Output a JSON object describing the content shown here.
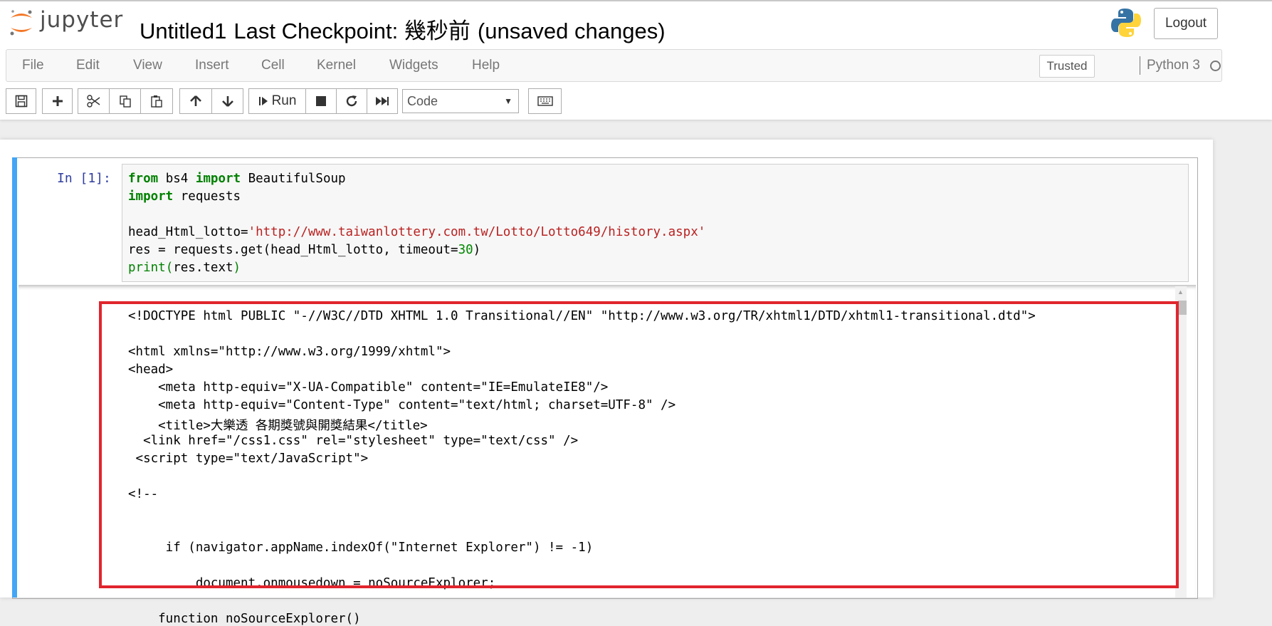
{
  "header": {
    "logo_text": "jupyter",
    "notebook_name": "Untitled1",
    "checkpoint": "Last Checkpoint: 幾秒前",
    "save_status": "(unsaved changes)",
    "logout_label": "Logout"
  },
  "menubar": {
    "items": [
      "File",
      "Edit",
      "View",
      "Insert",
      "Cell",
      "Kernel",
      "Widgets",
      "Help"
    ],
    "trusted_label": "Trusted",
    "kernel_name": "Python 3"
  },
  "toolbar": {
    "run_label": "Run",
    "cell_type": "Code",
    "icons": [
      "save-icon",
      "plus-icon",
      "cut-icon",
      "copy-icon",
      "paste-icon",
      "arrow-up-icon",
      "arrow-down-icon",
      "step-forward-icon",
      "stop-icon",
      "restart-icon",
      "fast-forward-icon",
      "keyboard-icon"
    ]
  },
  "cell": {
    "prompt": "In [1]:",
    "code": [
      [
        {
          "t": "from",
          "c": "kw"
        },
        {
          "t": " bs4 ",
          "c": ""
        },
        {
          "t": "import",
          "c": "kw"
        },
        {
          "t": " BeautifulSoup",
          "c": ""
        }
      ],
      [
        {
          "t": "import",
          "c": "kw"
        },
        {
          "t": " requests",
          "c": ""
        }
      ],
      [],
      [
        {
          "t": "head_Html_lotto=",
          "c": ""
        },
        {
          "t": "'http://www.taiwanlottery.com.tw/Lotto/Lotto649/history.aspx'",
          "c": "str"
        }
      ],
      [
        {
          "t": "res = requests.get(head_Html_lotto, timeout=",
          "c": ""
        },
        {
          "t": "30",
          "c": "num"
        },
        {
          "t": ")",
          "c": ""
        }
      ],
      [
        {
          "t": "print",
          "c": "bi"
        },
        {
          "t": "(",
          "c": "bi"
        },
        {
          "t": "res.text",
          "c": ""
        },
        {
          "t": ")",
          "c": "bi"
        }
      ]
    ],
    "output": [
      "<!DOCTYPE html PUBLIC \"-//W3C//DTD XHTML 1.0 Transitional//EN\" \"http://www.w3.org/TR/xhtml1/DTD/xhtml1-transitional.dtd\">",
      "",
      "<html xmlns=\"http://www.w3.org/1999/xhtml\">",
      "<head>",
      "    <meta http-equiv=\"X-UA-Compatible\" content=\"IE=EmulateIE8\"/>",
      "    <meta http-equiv=\"Content-Type\" content=\"text/html; charset=UTF-8\" />",
      "    <title>大樂透 各期獎號與開獎結果</title>",
      "  <link href=\"/css1.css\" rel=\"stylesheet\" type=\"text/css\" />",
      " <script type=\"text/JavaScript\">",
      "",
      "<!--",
      "",
      "",
      "     if (navigator.appName.indexOf(\"Internet Explorer\") != -1)",
      "",
      "         document.onmousedown = noSourceExplorer;",
      "",
      "    function noSourceExplorer()"
    ]
  },
  "colors": {
    "cell_selected_bar": "#42a5f5",
    "highlight_box": "#e0252d",
    "keyword": "#008000",
    "string": "#ba2121"
  }
}
